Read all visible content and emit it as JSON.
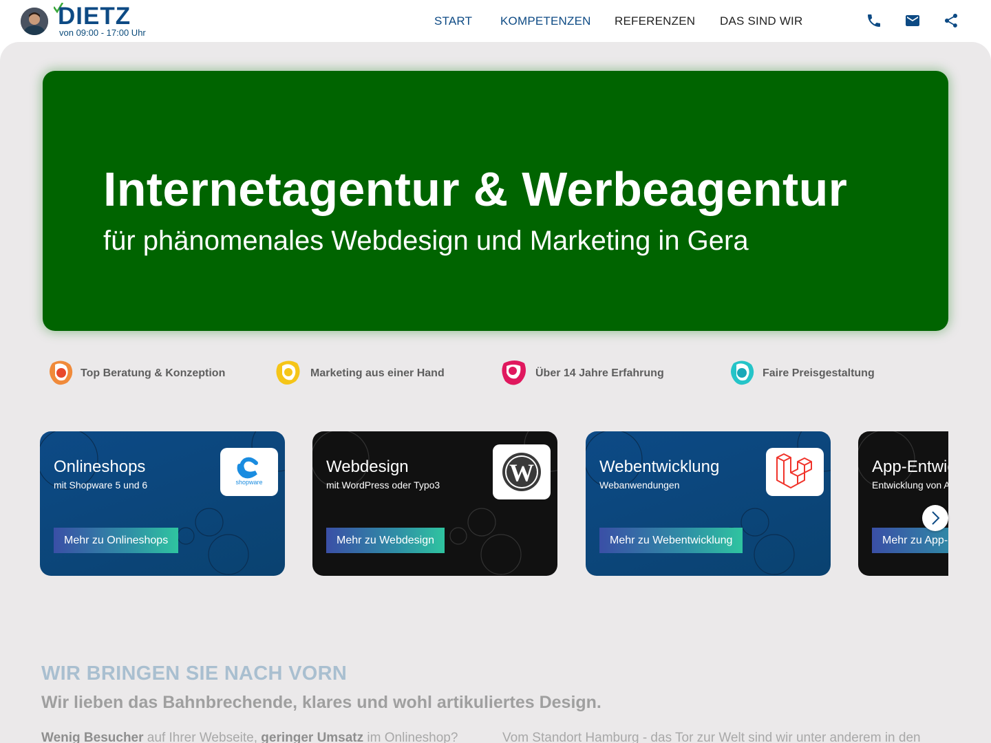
{
  "header": {
    "logo_text": "DIETZ",
    "hours": "von 09:00 - 17:00 Uhr",
    "nav": [
      {
        "label": "START"
      },
      {
        "label": "KOMPETENZEN"
      },
      {
        "label": "REFERENZEN"
      },
      {
        "label": "DAS SIND WIR"
      }
    ],
    "icons": [
      "phone-icon",
      "mail-icon",
      "share-icon"
    ],
    "colors": {
      "brand": "#0d4a84",
      "check": "#3aa83a"
    }
  },
  "hero": {
    "title": "Internetagentur & Werbeagentur",
    "subtitle": "für phänomenales Webdesign und Marketing in Gera",
    "background": "#006400"
  },
  "features": [
    {
      "label": "Top Beratung & Konzeption",
      "icon": "orange-blob-icon"
    },
    {
      "label": "Marketing aus einer Hand",
      "icon": "yellow-blob-icon"
    },
    {
      "label": "Über 14 Jahre Erfahrung",
      "icon": "pink-blob-icon"
    },
    {
      "label": "Faire Preisgestaltung",
      "icon": "teal-blob-icon"
    }
  ],
  "cards": [
    {
      "title": "Onlineshops",
      "subtitle": "mit Shopware 5 und 6",
      "button": "Mehr zu Onlineshops",
      "logo": "shopware-logo",
      "logo_text": "shopware",
      "theme": "blue"
    },
    {
      "title": "Webdesign",
      "subtitle": "mit WordPress oder Typo3",
      "button": "Mehr zu Webdesign",
      "logo": "wordpress-logo",
      "theme": "dark"
    },
    {
      "title": "Webentwicklung",
      "subtitle": "Webanwendungen",
      "button": "Mehr zu Webentwicklung",
      "logo": "laravel-logo",
      "theme": "blue"
    },
    {
      "title": "App-Entwicklung",
      "subtitle": "Entwicklung von Apps",
      "button": "Mehr zu App-Entwicklung",
      "theme": "dark"
    }
  ],
  "section": {
    "kicker": "WIR BRINGEN SIE NACH VORN",
    "title": "Wir lieben das Bahnbrechende, klares und wohl artikuliertes Design.",
    "body_parts": [
      "Wenig Besucher",
      " auf Ihrer Webseite, ",
      "geringer Umsatz",
      " im Onlineshop?"
    ],
    "body_right": "Vom Standort Hamburg - das Tor zur Welt sind wir unter anderem in den"
  }
}
